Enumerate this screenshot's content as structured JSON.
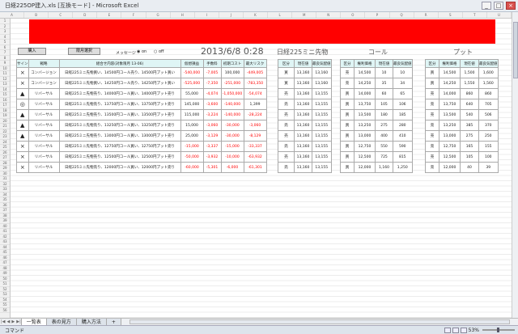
{
  "window": {
    "title": "日経225OP建入.xls [互換モード] - Microsoft Excel",
    "minimize": "_",
    "maximize": "□",
    "close": "×"
  },
  "columns": [
    "A",
    "B",
    "C",
    "D",
    "E",
    "F",
    "G",
    "H",
    "I",
    "J",
    "K",
    "L",
    "M",
    "N",
    "O",
    "P",
    "Q",
    "R",
    "S",
    "T",
    "U"
  ],
  "rows": [
    "1",
    "2",
    "3",
    "4",
    "5",
    "6",
    "7",
    "8",
    "9",
    "10",
    "11",
    "12",
    "13",
    "14",
    "15",
    "16",
    "17",
    "18",
    "19",
    "20",
    "21",
    "22",
    "23",
    "24",
    "25",
    "26",
    "27",
    "28",
    "29",
    "30",
    "31",
    "32",
    "33",
    "34",
    "35",
    "36",
    "37",
    "38",
    "39",
    "40",
    "41",
    "42",
    "43",
    "44",
    "45",
    "46",
    "47",
    "48",
    "49",
    "50",
    "51",
    "52",
    "53",
    "54",
    "55",
    "56"
  ],
  "buttons": {
    "purchase": "購入",
    "select": "限月選択"
  },
  "message": {
    "label": "メッセージ",
    "on": "◉ on",
    "off": "○ off"
  },
  "datetime": "2013/6/8 0:28",
  "product": "日経225ミニ先物",
  "call_title": "コール",
  "put_title": "プット",
  "main_headers": [
    "サイン",
    "戦略",
    "組合せ内容(対象限月 13-06)",
    "仮想損益",
    "手数料",
    "初期コスト",
    "最大リスク"
  ],
  "main_rows": [
    {
      "sign": "×",
      "strategy": "コンバージョン",
      "content": "日経225ミニ先物買い、14500円コール売り、14500円プット買い",
      "pl": "-540,000",
      "fee": "-7,005",
      "cost": "100,000",
      "risk": "-449,005"
    },
    {
      "sign": "×",
      "strategy": "コンバージョン",
      "content": "日経225ミニ先物買い、14250円コール売り、14250円プット買い",
      "pl": "-525,000",
      "fee": "-7,350",
      "cost": "-251,000",
      "risk": "-783,350"
    },
    {
      "sign": "▲",
      "strategy": "リバーサル",
      "content": "日経225ミニ先物売り、14000円コール買い、14000円プット売り",
      "pl": "55,000",
      "fee": "-4,074",
      "cost": "-1,050,000",
      "risk": "-54,074"
    },
    {
      "sign": "◎",
      "strategy": "リバーサル",
      "content": "日経225ミニ先物売り、13750円コール買い、13750円プット売り",
      "pl": "145,000",
      "fee": "-3,600",
      "cost": "-140,000",
      "risk": "1,399"
    },
    {
      "sign": "▲",
      "strategy": "リバーサル",
      "content": "日経225ミニ先物売り、13500円コール買い、13500円プット売り",
      "pl": "115,000",
      "fee": "-3,224",
      "cost": "-140,000",
      "risk": "-28,224"
    },
    {
      "sign": "▲",
      "strategy": "リバーサル",
      "content": "日経225ミニ先物売り、13250円コール買い、13250円プット売り",
      "pl": "15,000",
      "fee": "-3,060",
      "cost": "-30,000",
      "risk": "-3,060"
    },
    {
      "sign": "▲",
      "strategy": "リバーサル",
      "content": "日経225ミニ先物売り、13000円コール買い、13000円プット売り",
      "pl": "25,000",
      "fee": "-3,129",
      "cost": "-30,000",
      "risk": "-8,129"
    },
    {
      "sign": "×",
      "strategy": "リバーサル",
      "content": "日経225ミニ先物売り、12750円コール買い、12750円プット売り",
      "pl": "-15,000",
      "fee": "-3,337",
      "cost": "-15,000",
      "risk": "-33,337"
    },
    {
      "sign": "×",
      "strategy": "リバーサル",
      "content": "日経225ミニ先物売り、12500円コール買い、12500円プット売り",
      "pl": "-50,000",
      "fee": "-3,932",
      "cost": "-10,000",
      "risk": "-63,932"
    },
    {
      "sign": "×",
      "strategy": "リバーサル",
      "content": "日経225ミニ先物売り、12000円コール買い、12000円プット売り",
      "pl": "-60,000",
      "fee": "-5,301",
      "cost": "-6,000",
      "risk": "-61,301"
    }
  ],
  "prod_headers": [
    "区分",
    "現在値",
    "最良気配値"
  ],
  "prod_rows": [
    [
      "買",
      "13,160",
      "13,160"
    ],
    [
      "買",
      "13,160",
      "13,160"
    ],
    [
      "売",
      "13,160",
      "13,155"
    ],
    [
      "売",
      "13,160",
      "13,155"
    ],
    [
      "売",
      "13,160",
      "13,155"
    ],
    [
      "売",
      "13,160",
      "13,155"
    ],
    [
      "売",
      "13,160",
      "13,155"
    ],
    [
      "売",
      "13,160",
      "13,155"
    ],
    [
      "売",
      "13,160",
      "13,155"
    ],
    [
      "売",
      "13,160",
      "13,155"
    ]
  ],
  "opt_headers": [
    "区分",
    "権利価格",
    "現在値",
    "最良気配値"
  ],
  "call_rows": [
    [
      "売",
      "14,500",
      "10",
      "10"
    ],
    [
      "売",
      "14,250",
      "35",
      "34"
    ],
    [
      "買",
      "14,000",
      "60",
      "65"
    ],
    [
      "買",
      "13,750",
      "105",
      "106"
    ],
    [
      "買",
      "13,500",
      "180",
      "185"
    ],
    [
      "買",
      "13,250",
      "275",
      "280"
    ],
    [
      "買",
      "13,000",
      "400",
      "410"
    ],
    [
      "買",
      "12,750",
      "550",
      "590"
    ],
    [
      "買",
      "12,500",
      "725",
      "815"
    ],
    [
      "買",
      "12,000",
      "1,160",
      "1,250"
    ]
  ],
  "put_rows": [
    [
      "買",
      "14,500",
      "1,500",
      "1,600"
    ],
    [
      "買",
      "14,250",
      "1,550",
      "1,560"
    ],
    [
      "売",
      "14,000",
      "860",
      "860"
    ],
    [
      "売",
      "13,750",
      "640",
      "705"
    ],
    [
      "売",
      "13,500",
      "540",
      "506"
    ],
    [
      "売",
      "13,250",
      "385",
      "370"
    ],
    [
      "売",
      "13,000",
      "275",
      "250"
    ],
    [
      "売",
      "12,750",
      "165",
      "155"
    ],
    [
      "売",
      "12,500",
      "105",
      "100"
    ],
    [
      "売",
      "12,000",
      "40",
      "39"
    ]
  ],
  "sheet_tabs": [
    "一覧表",
    "表の見方",
    "購入方法"
  ],
  "status": {
    "mode": "コマンド",
    "zoom": "53%"
  }
}
